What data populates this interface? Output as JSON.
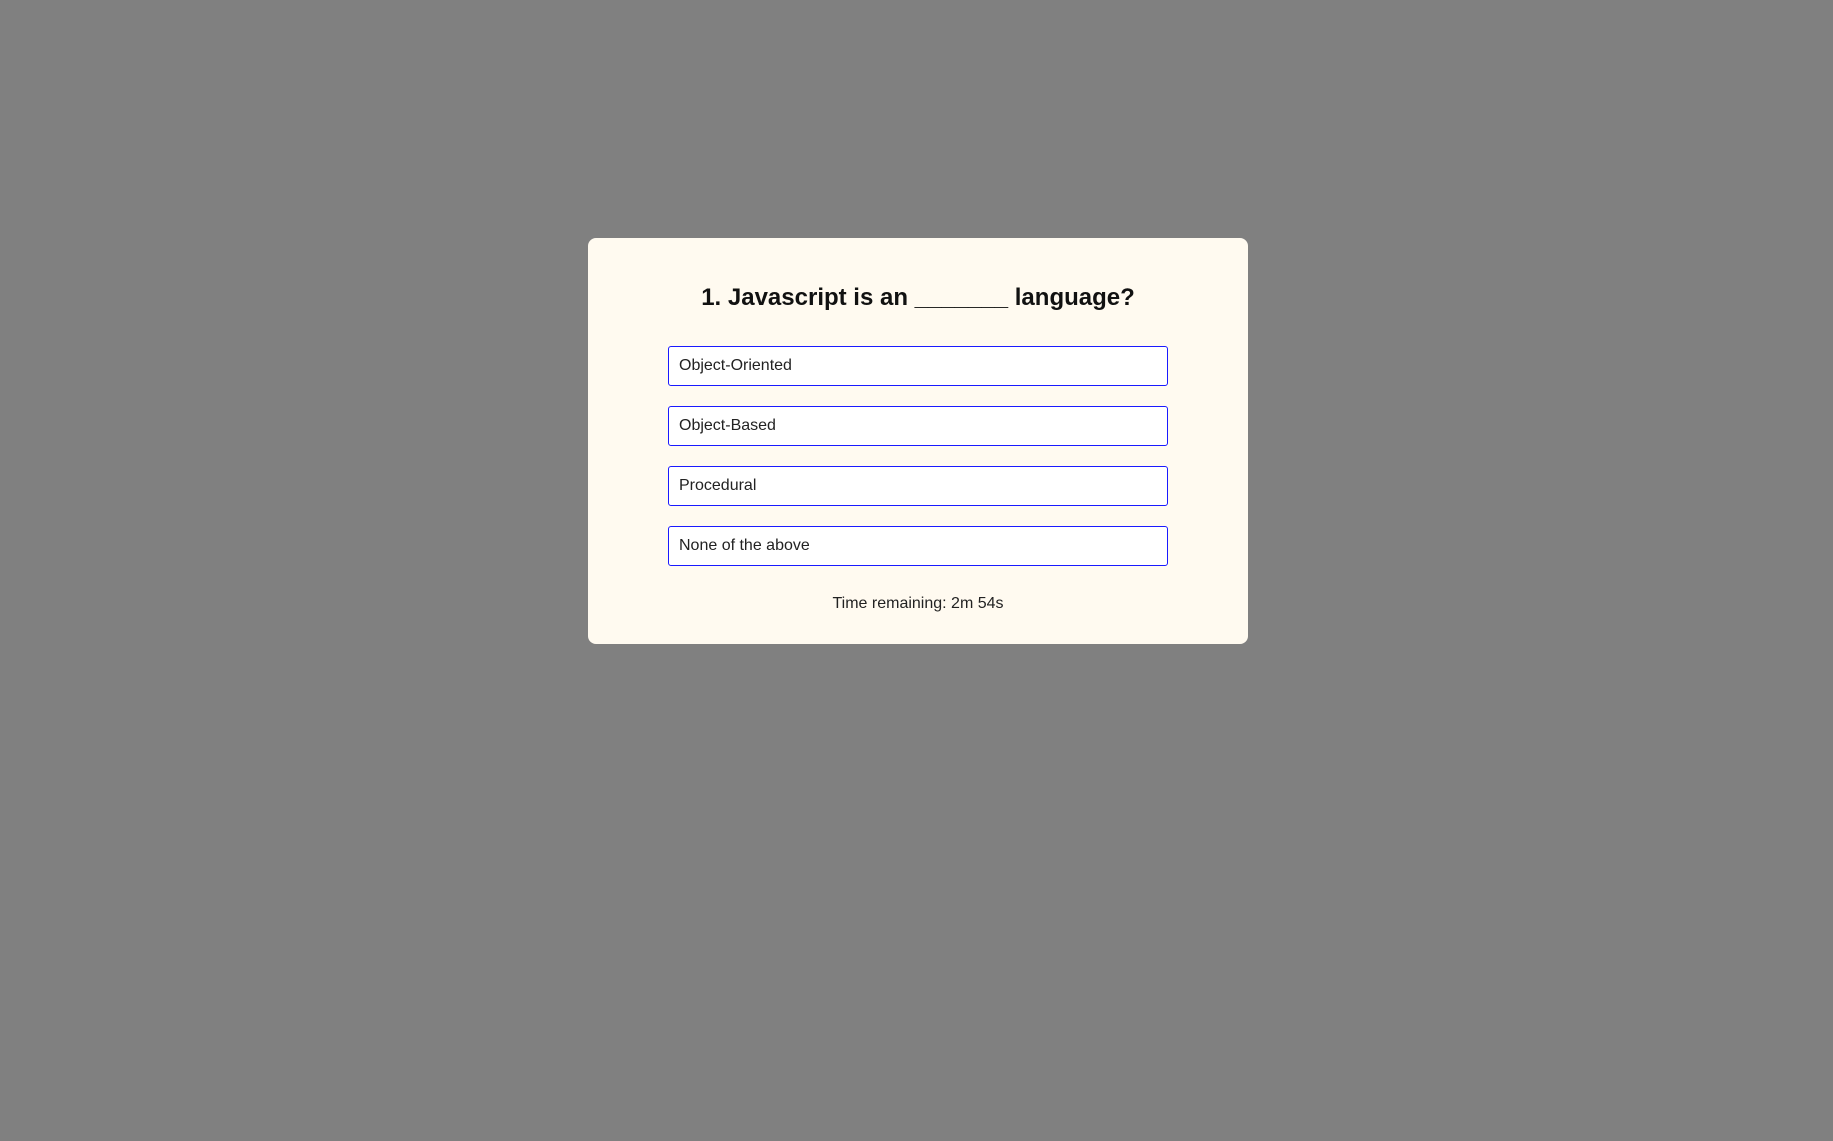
{
  "quiz": {
    "question": "1. Javascript is an _______ language?",
    "options": [
      {
        "label": "Object-Oriented"
      },
      {
        "label": "Object-Based"
      },
      {
        "label": "Procedural"
      },
      {
        "label": "None of the above"
      }
    ],
    "timer_text": "Time remaining: 2m 54s"
  },
  "colors": {
    "page_background": "#808080",
    "card_background": "#fffaf0",
    "option_border": "#1a1aff",
    "text": "#111111"
  }
}
